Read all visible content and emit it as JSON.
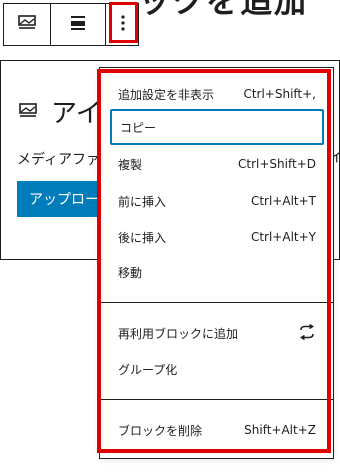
{
  "page_heading_peek": "ックを追加",
  "card": {
    "title": "アイ",
    "description": "メディアファー",
    "right_peek": "イ",
    "upload_label": "アップロード"
  },
  "menu": {
    "group1": [
      {
        "label": "追加設定を非表示",
        "shortcut": "Ctrl+Shift+,"
      },
      {
        "label": "コピー",
        "shortcut": ""
      },
      {
        "label": "複製",
        "shortcut": "Ctrl+Shift+D"
      },
      {
        "label": "前に挿入",
        "shortcut": "Ctrl+Alt+T"
      },
      {
        "label": "後に挿入",
        "shortcut": "Ctrl+Alt+Y"
      },
      {
        "label": "移動",
        "shortcut": ""
      }
    ],
    "group2": [
      {
        "label": "再利用ブロックに追加",
        "icon": "reusable-block-icon"
      },
      {
        "label": "グループ化"
      }
    ],
    "group3": [
      {
        "label": "ブロックを削除",
        "shortcut": "Shift+Alt+Z"
      }
    ]
  },
  "colors": {
    "highlight": "#e00000",
    "focus": "#007cba",
    "button": "#007cba"
  }
}
